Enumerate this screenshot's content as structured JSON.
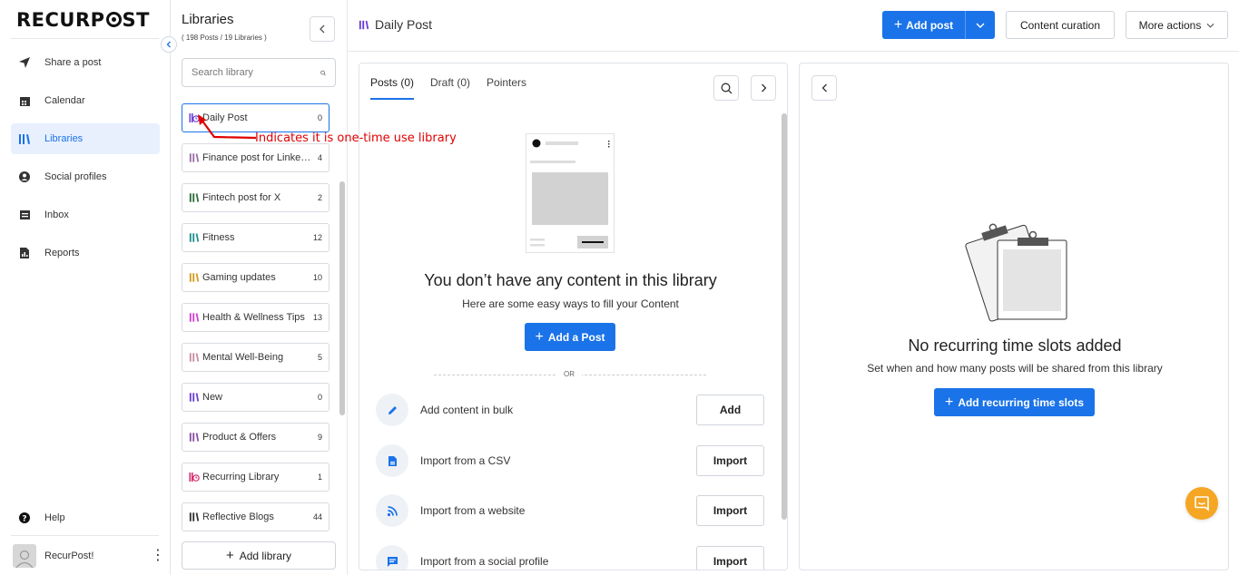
{
  "nav": {
    "items": [
      {
        "label": "Share a post",
        "icon": "send-icon"
      },
      {
        "label": "Calendar",
        "icon": "calendar-icon"
      },
      {
        "label": "Libraries",
        "icon": "libraries-icon",
        "active": true
      },
      {
        "label": "Social profiles",
        "icon": "user-circle-icon"
      },
      {
        "label": "Inbox",
        "icon": "inbox-icon"
      },
      {
        "label": "Reports",
        "icon": "report-icon"
      }
    ],
    "help_label": "Help",
    "user_name": "RecurPost!"
  },
  "libraries": {
    "title": "Libraries",
    "subtitle": "( 198 Posts / 19 Libraries )",
    "search_placeholder": "Search library",
    "add_label": "Add library",
    "items": [
      {
        "name": "Daily Post",
        "count": "0",
        "color": "#6b3fd4",
        "one_time": true
      },
      {
        "name": "Finance post for LinkedIn",
        "count": "4",
        "color": "#9c6fa8"
      },
      {
        "name": "Fintech post for X",
        "count": "2",
        "color": "#2e6b3a"
      },
      {
        "name": "Fitness",
        "count": "12",
        "color": "#1f8f8f"
      },
      {
        "name": "Gaming updates",
        "count": "10",
        "color": "#d49a1e"
      },
      {
        "name": "Health & Wellness Tips",
        "count": "13",
        "color": "#d43fd4"
      },
      {
        "name": "Mental Well-Being",
        "count": "5",
        "color": "#c78fa0"
      },
      {
        "name": "New",
        "count": "0",
        "color": "#6b3fd4"
      },
      {
        "name": "Product & Offers",
        "count": "9",
        "color": "#8a4fa8"
      },
      {
        "name": "Recurring Library",
        "count": "1",
        "color": "#d4286b",
        "one_time": true
      },
      {
        "name": "Reflective Blogs",
        "count": "44",
        "color": "#333333"
      }
    ]
  },
  "annotation": "Indicates it is one-time use library",
  "header": {
    "title": "Daily Post",
    "add_post": "Add post",
    "content_curation": "Content curation",
    "more_actions": "More actions"
  },
  "posts": {
    "tabs": [
      "Posts (0)",
      "Draft (0)",
      "Pointers"
    ],
    "empty_title": "You don’t have any content in this library",
    "empty_sub": "Here are some easy ways to fill your Content",
    "add_post": "Add a Post",
    "or": "OR",
    "options": [
      {
        "label": "Add content in bulk",
        "button": "Add",
        "icon": "pencil-icon"
      },
      {
        "label": "Import from a CSV",
        "button": "Import",
        "icon": "file-icon"
      },
      {
        "label": "Import from a website",
        "button": "Import",
        "icon": "rss-icon"
      },
      {
        "label": "Import from a social profile",
        "button": "Import",
        "icon": "message-icon"
      }
    ]
  },
  "slots": {
    "title": "No recurring time slots added",
    "sub": "Set when and how many posts will be shared from this library",
    "button": "Add recurring time slots"
  },
  "colors": {
    "accent": "#1a73e8",
    "chat": "#f5a623",
    "annotation": "#e00000"
  }
}
